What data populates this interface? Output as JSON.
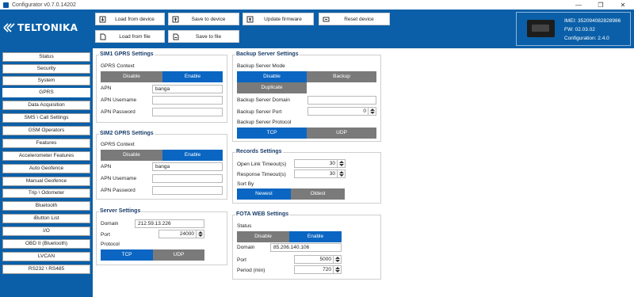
{
  "window": {
    "title": "Configurator v0.7.0.14202",
    "minimize": "—",
    "restore": "❐",
    "close": "✕"
  },
  "header": {
    "logo_text": "TELTONIKA",
    "buttons": {
      "load_device": "Load from device",
      "save_device": "Save to device",
      "update_fw": "Update firmware",
      "reset": "Reset device",
      "load_file": "Load from file",
      "save_file": "Save to file"
    },
    "device": {
      "imei": "IMEI: 352094082828986",
      "fw": "FW: 02.03.02",
      "config": "Configuration: 2.4.0"
    }
  },
  "sidebar": {
    "items": [
      "Status",
      "Security",
      "System",
      "GPRS",
      "Data Acquisition",
      "SMS \\ Call Settings",
      "GSM Operators",
      "Features",
      "Accelerometer Features",
      "Auto Geofence",
      "Manual Geofence",
      "Trip \\ Odometer",
      "Bluetooth",
      "iButton List",
      "I/O",
      "OBD II (Bluetooth)",
      "LVCAN",
      "RS232 \\ RS485"
    ],
    "active": "GPRS"
  },
  "sim1": {
    "title": "SIM1 GPRS Settings",
    "context_label": "GPRS Context",
    "disable": "Disable",
    "enable": "Enable",
    "apn_label": "APN",
    "apn_value": "banga",
    "user_label": "APN Username",
    "user_value": "",
    "pass_label": "APN Password",
    "pass_value": ""
  },
  "sim2": {
    "title": "SIM2 GPRS Settings",
    "context_label": "GPRS Context",
    "disable": "Disable",
    "enable": "Enable",
    "apn_label": "APN",
    "apn_value": "banga",
    "user_label": "APN Username",
    "user_value": "",
    "pass_label": "APN Password",
    "pass_value": ""
  },
  "server": {
    "title": "Server Settings",
    "domain_label": "Domain",
    "domain_value": "212.59.13.226",
    "port_label": "Port",
    "port_value": "24000",
    "protocol_label": "Protocol",
    "tcp": "TCP",
    "udp": "UDP"
  },
  "backup": {
    "title": "Backup Server Settings",
    "mode_label": "Backup Server Mode",
    "disable": "Disable",
    "backup": "Backup",
    "duplicate": "Duplicate",
    "domain_label": "Backup Server Domain",
    "domain_value": "",
    "port_label": "Backup Server Port",
    "port_value": "0",
    "protocol_label": "Backup Server Protocol",
    "tcp": "TCP",
    "udp": "UDP"
  },
  "records": {
    "title": "Records Settings",
    "open_label": "Open Link Timeout(s)",
    "open_value": "30",
    "resp_label": "Response Timeout(s)",
    "resp_value": "30",
    "sort_label": "Sort By",
    "newest": "Newest",
    "oldest": "Oldest"
  },
  "fota": {
    "title": "FOTA WEB Settings",
    "status_label": "Status",
    "disable": "Disable",
    "enable": "Enable",
    "domain_label": "Domain",
    "domain_value": "85.206.140.106",
    "port_label": "Port",
    "port_value": "5000",
    "period_label": "Period (min)",
    "period_value": "720"
  }
}
